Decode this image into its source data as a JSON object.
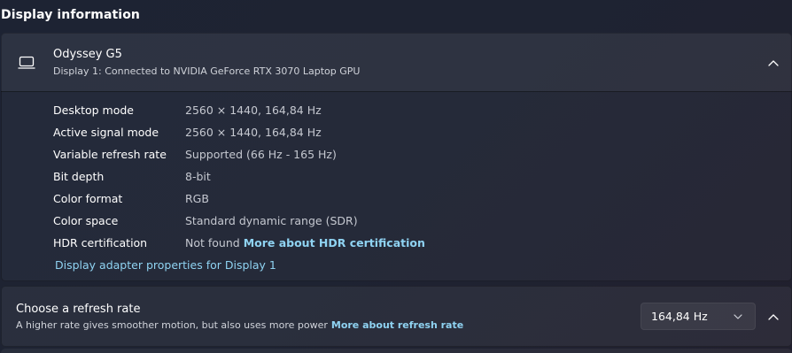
{
  "section": {
    "title": "Display information"
  },
  "display": {
    "name": "Odyssey G5",
    "subtitle": "Display 1: Connected to NVIDIA GeForce RTX 3070 Laptop GPU",
    "icon": "monitor-icon",
    "collapse_icon": "chevron-up-icon"
  },
  "info": {
    "rows": [
      {
        "label": "Desktop mode",
        "value": "2560 × 1440, 164,84 Hz"
      },
      {
        "label": "Active signal mode",
        "value": "2560 × 1440, 164,84 Hz"
      },
      {
        "label": "Variable refresh rate",
        "value": "Supported (66 Hz - 165 Hz)"
      },
      {
        "label": "Bit depth",
        "value": "8-bit"
      },
      {
        "label": "Color format",
        "value": "RGB"
      },
      {
        "label": "Color space",
        "value": "Standard dynamic range (SDR)"
      },
      {
        "label": "HDR certification",
        "value": "Not found",
        "link": "More about HDR certification"
      }
    ],
    "adapter_link": "Display adapter properties for Display 1"
  },
  "refresh": {
    "title": "Choose a refresh rate",
    "subtitle": "A higher rate gives smoother motion, but also uses more power",
    "link": "More about refresh rate",
    "selected": "164,84 Hz",
    "dropdown_icon": "chevron-down-icon",
    "collapse_icon": "chevron-up-icon"
  },
  "colors": {
    "link": "#8fd3f2",
    "background": "#1d2333"
  }
}
